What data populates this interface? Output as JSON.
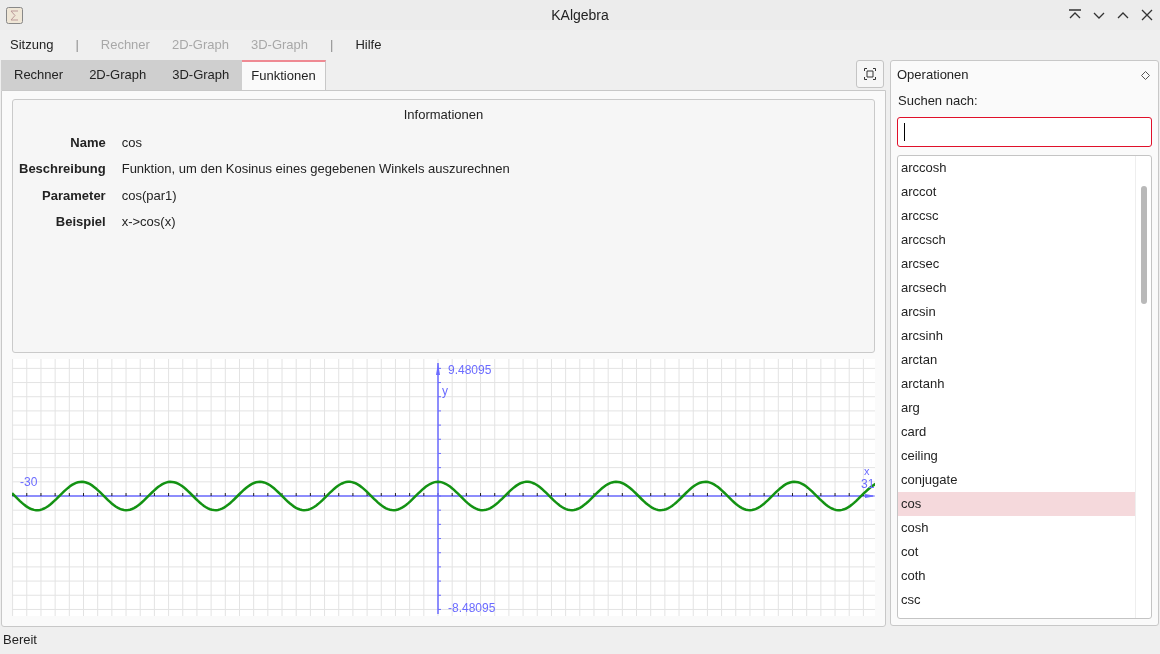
{
  "window": {
    "title": "KAlgebra"
  },
  "menu": [
    {
      "label": "Sitzung",
      "disabled": false,
      "kind": "item"
    },
    {
      "label": "|",
      "kind": "separator"
    },
    {
      "label": "Rechner",
      "disabled": true,
      "kind": "item"
    },
    {
      "label": "2D-Graph",
      "disabled": true,
      "kind": "item"
    },
    {
      "label": "3D-Graph",
      "disabled": true,
      "kind": "item"
    },
    {
      "label": "|",
      "kind": "separator"
    },
    {
      "label": "Hilfe",
      "disabled": false,
      "kind": "item"
    }
  ],
  "tabs": [
    {
      "label": "Rechner",
      "selected": false
    },
    {
      "label": "2D-Graph",
      "selected": false
    },
    {
      "label": "3D-Graph",
      "selected": false
    },
    {
      "label": "Funktionen",
      "selected": true
    }
  ],
  "info": {
    "title": "Informationen",
    "rows": [
      {
        "label": "Name",
        "value": "cos"
      },
      {
        "label": "Beschreibung",
        "value": "Funktion, um den Kosinus eines gegebenen Winkels auszurechnen"
      },
      {
        "label": "Parameter",
        "value": "cos(par1)"
      },
      {
        "label": "Beispiel",
        "value": "x->cos(x)"
      }
    ]
  },
  "plot": {
    "x_min": "-30",
    "x_max": "31",
    "x_axis": "x",
    "y_max": "9.48095",
    "y_min": "-8.48095",
    "y_axis": "y"
  },
  "dock": {
    "title": "Operationen",
    "search_label": "Suchen nach:",
    "items": [
      {
        "label": "arccosh",
        "selected": false
      },
      {
        "label": "arccot",
        "selected": false
      },
      {
        "label": "arccsc",
        "selected": false
      },
      {
        "label": "arccsch",
        "selected": false
      },
      {
        "label": "arcsec",
        "selected": false
      },
      {
        "label": "arcsech",
        "selected": false
      },
      {
        "label": "arcsin",
        "selected": false
      },
      {
        "label": "arcsinh",
        "selected": false
      },
      {
        "label": "arctan",
        "selected": false
      },
      {
        "label": "arctanh",
        "selected": false
      },
      {
        "label": "arg",
        "selected": false
      },
      {
        "label": "card",
        "selected": false
      },
      {
        "label": "ceiling",
        "selected": false
      },
      {
        "label": "conjugate",
        "selected": false
      },
      {
        "label": "cos",
        "selected": true
      },
      {
        "label": "cosh",
        "selected": false
      },
      {
        "label": "cot",
        "selected": false
      },
      {
        "label": "coth",
        "selected": false
      },
      {
        "label": "csc",
        "selected": false
      }
    ]
  },
  "status_bar": "Bereit"
}
